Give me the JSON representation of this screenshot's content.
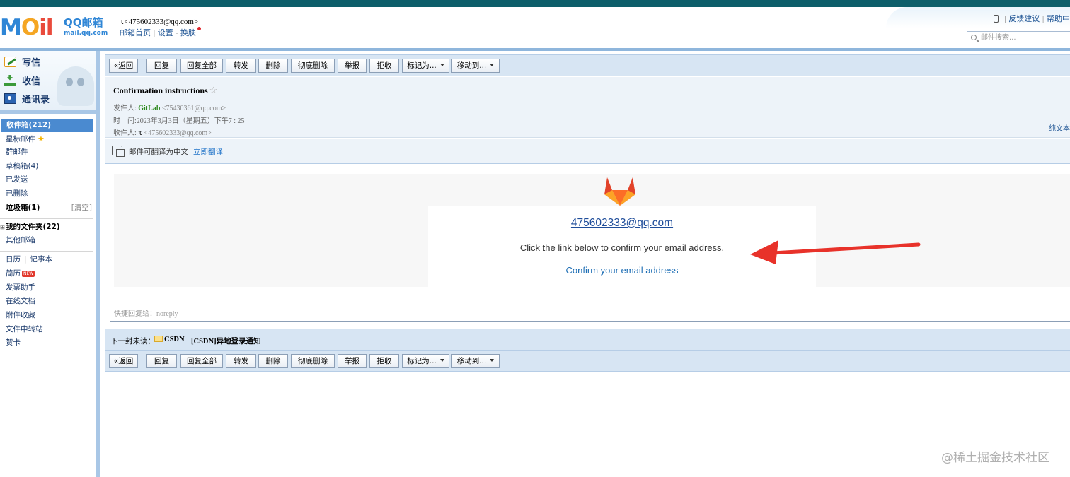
{
  "header": {
    "logo_text": "M",
    "logo_o": "O",
    "logo_il": "il",
    "brand": "QQ邮箱",
    "domain": "mail.qq.com",
    "account": "ꚍ<475602333@qq.com>",
    "links": [
      "邮箱首页",
      "设置",
      "换肤"
    ],
    "top_links": [
      "反馈建议",
      "帮助中"
    ],
    "search_placeholder": "邮件搜索..."
  },
  "sidebar": {
    "commands": [
      "写信",
      "收信",
      "通讯录"
    ],
    "folders": [
      "收件箱(212)",
      "星标邮件",
      "群邮件",
      "草稿箱(4)",
      "已发送",
      "已删除",
      "垃圾箱(1)"
    ],
    "trash_clear": "[清空]",
    "my_folders": "我的文件夹(22)",
    "other_mailbox": "其他邮箱",
    "tools": [
      "日历",
      "记事本",
      "简历",
      "发票助手",
      "在线文档",
      "附件收藏",
      "文件中转站",
      "贺卡"
    ],
    "new_badge": "NEW"
  },
  "toolbar": {
    "back": "«返回",
    "reply": "回复",
    "reply_all": "回复全部",
    "forward": "转发",
    "delete": "删除",
    "delete_perm": "彻底删除",
    "report": "举报",
    "reject": "拒收",
    "mark_as": "标记为...",
    "move_to": "移动到..."
  },
  "mail": {
    "subject": "Confirmation instructions",
    "from_label": "发件人:",
    "from_name": "GitLab",
    "from_addr": "<75430361@qq.com>",
    "time_label": "时　间:",
    "time": "2023年3月3日（星期五）下午7 : 25",
    "to_label": "收件人:",
    "to_name": "ꚍ",
    "to_addr": "<475602333@qq.com>",
    "plain_text": "纯文本"
  },
  "translate": {
    "label": "邮件可翻译为中文",
    "link": "立即翻译"
  },
  "body": {
    "email": "475602333@qq.com",
    "instruction": "Click the link below to confirm your email address.",
    "confirm_link": "Confirm your email address"
  },
  "quick_reply_placeholder": "快捷回复给：noreply",
  "next_unread": {
    "label": "下一封未读：",
    "from": "CSDN",
    "subject": "[CSDN]异地登录通知"
  },
  "watermark": "@稀土掘金技术社区",
  "colors": {
    "accent_blue": "#4a8ad0",
    "toolbar_bg": "#d7e5f3",
    "arrow_red": "#e8322a",
    "gitlab_orange": "#e2432a"
  }
}
